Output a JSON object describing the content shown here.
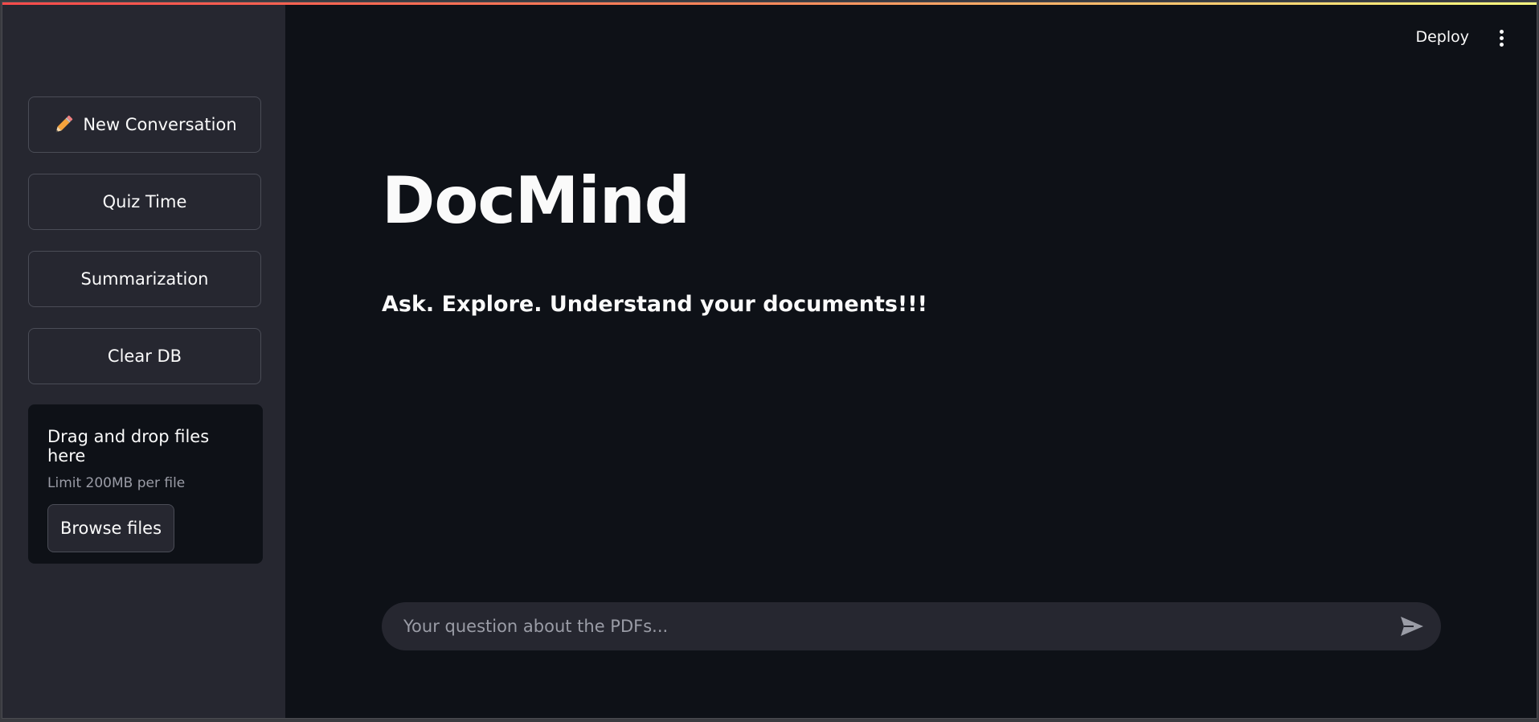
{
  "header": {
    "deploy_label": "Deploy",
    "menu_icon": "kebab-vertical-icon",
    "accent_colors": [
      "#ff4b4b",
      "#fffd80"
    ]
  },
  "sidebar": {
    "buttons": [
      {
        "label": "New Conversation",
        "icon": "pencil-icon"
      },
      {
        "label": "Quiz Time"
      },
      {
        "label": "Summarization"
      },
      {
        "label": "Clear DB"
      }
    ],
    "uploader": {
      "title": "Drag and drop files here",
      "limit": "Limit 200MB per file",
      "browse_label": "Browse files"
    }
  },
  "main": {
    "title": "DocMind",
    "subtitle": "Ask. Explore. Understand your documents!!!"
  },
  "chat": {
    "placeholder": "Your question about the PDFs...",
    "send_icon": "send-icon"
  },
  "colors": {
    "background": "#0e1117",
    "sidebar": "#262730",
    "text": "#fafafa",
    "muted": "#9a9ca6"
  }
}
